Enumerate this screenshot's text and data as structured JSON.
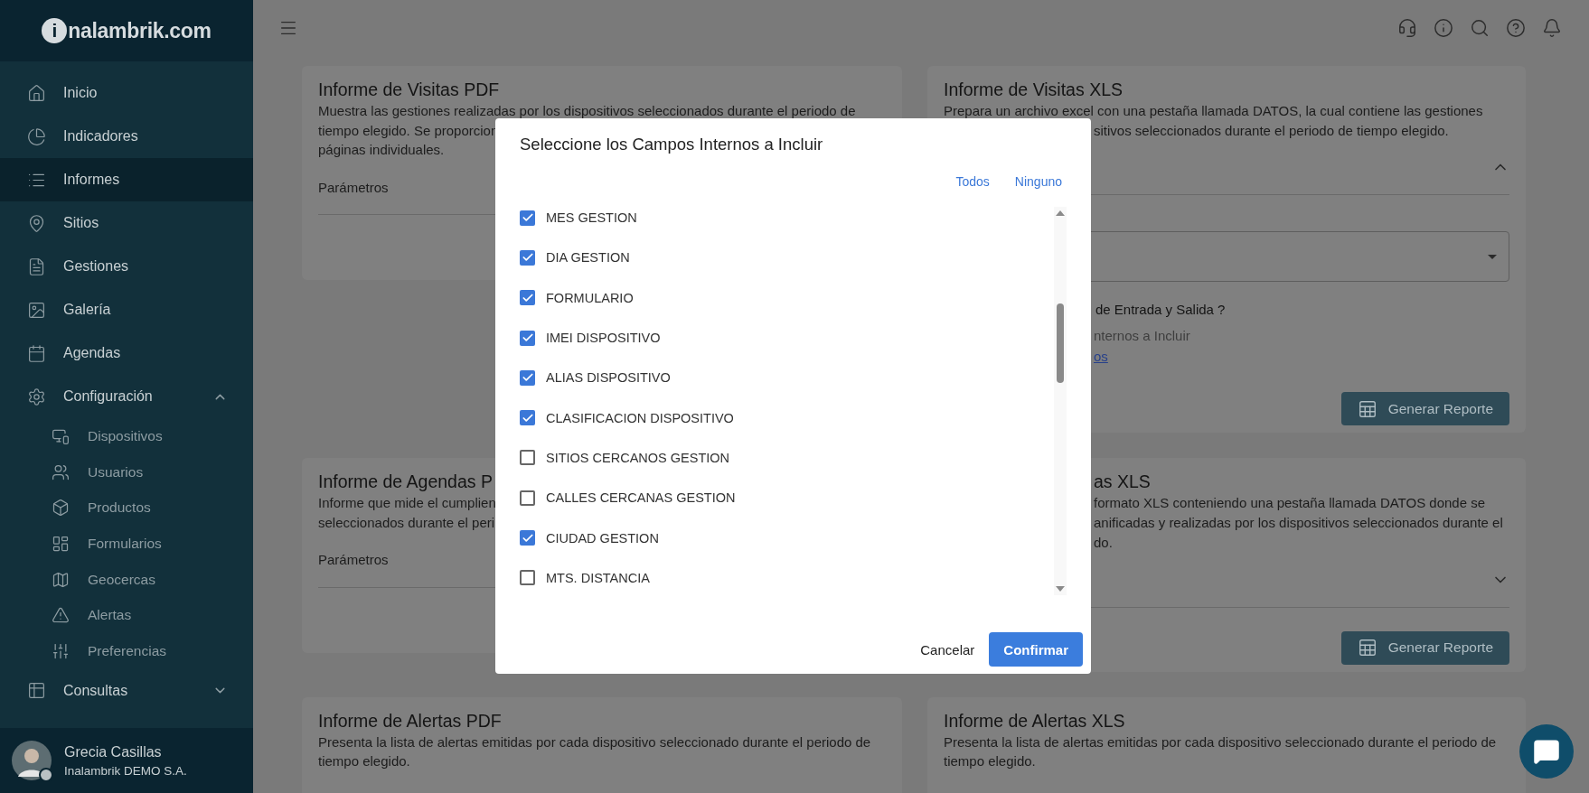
{
  "sidebar": {
    "logo": {
      "mark": "i",
      "text": "nalambrik.com"
    },
    "items": [
      {
        "label": "Inicio",
        "selected": false
      },
      {
        "label": "Indicadores",
        "selected": false
      },
      {
        "label": "Informes",
        "selected": true
      },
      {
        "label": "Sitios",
        "selected": false
      },
      {
        "label": "Gestiones",
        "selected": false
      },
      {
        "label": "Galería",
        "selected": false
      },
      {
        "label": "Agendas",
        "selected": false
      },
      {
        "label": "Configuración",
        "selected": false,
        "expanded": true,
        "children": [
          {
            "label": "Dispositivos"
          },
          {
            "label": "Usuarios"
          },
          {
            "label": "Productos"
          },
          {
            "label": "Formularios"
          },
          {
            "label": "Geocercas"
          },
          {
            "label": "Alertas"
          },
          {
            "label": "Preferencias"
          }
        ]
      },
      {
        "label": "Consultas",
        "selected": false,
        "expanded": false
      }
    ],
    "user": {
      "name": "Grecia Casillas",
      "company": "Inalambrik DEMO S.A."
    }
  },
  "cards": [
    {
      "title": {
        "text": "Informe de Visitas PDF",
        "cut_start": false
      },
      "lines": [
        {
          "text": "Muestra las gestiones realizadas por los dispositivos seleccionados durante el periodo de",
          "cut_start": false
        },
        {
          "text": "tiempo elegido. Se proporcion",
          "cut_start": false
        },
        {
          "text": "páginas individuales.",
          "cut_start": false
        }
      ],
      "section": {
        "label": "Parámetros"
      }
    },
    {
      "title": {
        "text": "Informe de Visitas XLS",
        "cut_start": false
      },
      "lines": [
        {
          "text": "Prepara un archivo excel con una pestaña llamada DATOS, la cual contiene las gestiones",
          "cut_start": false
        },
        {
          "text": "sitivos seleccionados durante el periodo de tiempo elegido.",
          "cut_start": true
        }
      ],
      "section": {
        "expanded": true
      },
      "fields": [
        {
          "kind": "select"
        },
        {
          "kind": "question",
          "text": "de Entrada y Salida ?"
        },
        {
          "kind": "hint",
          "text": "nternos a Incluir"
        },
        {
          "kind": "link",
          "text": "os"
        }
      ],
      "button": "Generar Reporte"
    },
    {
      "title": {
        "text": "Informe de Agendas P",
        "cut_start": false
      },
      "lines": [
        {
          "text": "Informe que mide el cumplien",
          "cut_start": false
        },
        {
          "text": "seleccionados durante el peri",
          "cut_start": false
        }
      ],
      "section": {
        "label": "Parámetros"
      }
    },
    {
      "title": {
        "text": "as XLS",
        "cut_start": true
      },
      "lines": [
        {
          "text": "formato XLS conteniendo una pestaña llamada DATOS donde se",
          "cut_start": true
        },
        {
          "text": "anificadas y realizadas por los dispositivos seleccionados durante el",
          "cut_start": true
        },
        {
          "text": "do.",
          "cut_start": true
        }
      ],
      "section": {
        "expanded": false
      },
      "button": "Generar Reporte"
    },
    {
      "title": {
        "text": "Informe de Alertas PDF",
        "cut_start": false
      },
      "lines": [
        {
          "text": "Presenta la lista de alertas emitidas por cada dispositivo seleccionado durante el periodo de",
          "cut_start": false
        },
        {
          "text": "tiempo elegido.",
          "cut_start": false
        }
      ]
    },
    {
      "title": {
        "text": "Informe de Alertas XLS",
        "cut_start": false
      },
      "lines": [
        {
          "text": "Presenta la lista de alertas emitidas por cada dispositivo seleccionado durante el periodo de",
          "cut_start": false
        },
        {
          "text": "tiempo elegido.",
          "cut_start": false
        }
      ]
    }
  ],
  "modal": {
    "title": "Seleccione los Campos Internos a Incluir",
    "actions": [
      "Todos",
      "Ninguno"
    ],
    "fields": [
      {
        "label": "MES GESTION",
        "checked": true
      },
      {
        "label": "DIA GESTION",
        "checked": true
      },
      {
        "label": "FORMULARIO",
        "checked": true
      },
      {
        "label": "IMEI DISPOSITIVO",
        "checked": true
      },
      {
        "label": "ALIAS DISPOSITIVO",
        "checked": true
      },
      {
        "label": "CLASIFICACION DISPOSITIVO",
        "checked": true
      },
      {
        "label": "SITIOS CERCANOS GESTION",
        "checked": false
      },
      {
        "label": "CALLES CERCANAS GESTION",
        "checked": false
      },
      {
        "label": "CIUDAD GESTION",
        "checked": true
      },
      {
        "label": "MTS. DISTANCIA",
        "checked": false
      }
    ],
    "buttons": [
      {
        "label": "Cancelar",
        "kind": "text"
      },
      {
        "label": "Confirmar",
        "kind": "primary"
      }
    ]
  }
}
